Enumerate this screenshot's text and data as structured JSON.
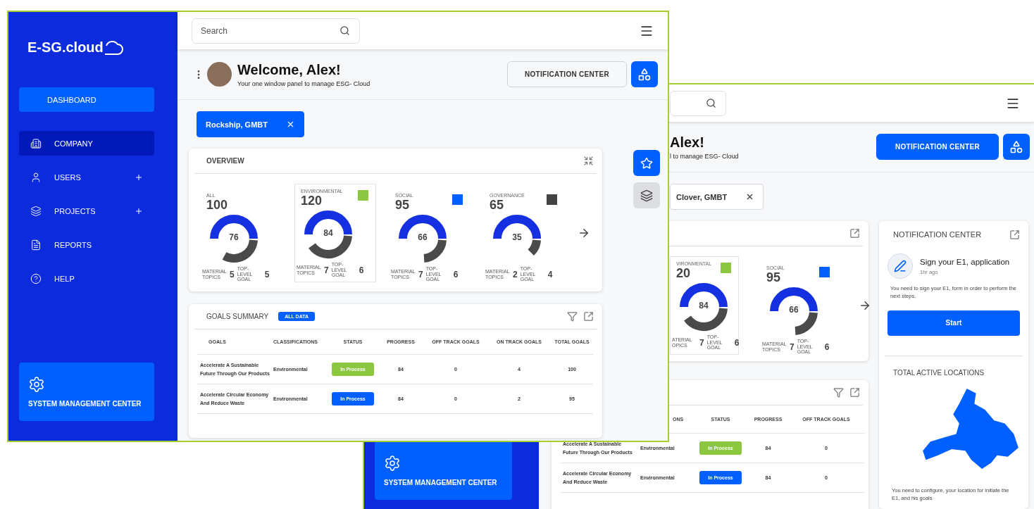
{
  "front": {
    "sidebar": {
      "logo": "E-SG.cloud",
      "items": [
        {
          "label": "DASHBOARD",
          "kind": "button",
          "selected": false,
          "expandable": false
        },
        {
          "label": "COMPANY",
          "kind": "link",
          "selected": true,
          "expandable": false
        },
        {
          "label": "USERS",
          "kind": "link",
          "selected": false,
          "expandable": true
        },
        {
          "label": "PROJECTS",
          "kind": "link",
          "selected": false,
          "expandable": true
        },
        {
          "label": "REPORTS",
          "kind": "link",
          "selected": false,
          "expandable": false
        },
        {
          "label": "HELP",
          "kind": "link",
          "selected": false,
          "expandable": false
        }
      ],
      "system_button": "SYSTEM MANAGEMENT CENTER"
    },
    "search": {
      "placeholder": "Search"
    },
    "welcome": {
      "title": "Welcome, Alex!",
      "subtitle": "Your one window panel to manage ESG- Cloud"
    },
    "notification_button": {
      "label": "NOTIFICATION CENTER",
      "filled": false
    },
    "chip": {
      "label": "Rockship, GMBT",
      "filled": true
    },
    "overview": {
      "title": "OVERVIEW",
      "items": [
        {
          "label": "ALL",
          "value": "100",
          "center": "76",
          "material_label": "MATERIAL TOPICS",
          "material": "5",
          "goal_label": "TOP-LEVEL GOAL",
          "goals": "5",
          "selected": false
        },
        {
          "label": "ENVIRONMENTAL",
          "value": "120",
          "color": "#8dc63f",
          "center": "84",
          "material_label": "MATERIAL TOPICS",
          "material": "7",
          "goal_label": "TOP-LEVEL GOAL",
          "goals": "6",
          "selected": true
        },
        {
          "label": "SOCIAL",
          "value": "95",
          "color": "#0060ff",
          "center": "66",
          "material_label": "MATERIAL TOPICS",
          "material": "7",
          "goal_label": "TOP-LEVEL GOAL",
          "goals": "6",
          "selected": false
        },
        {
          "label": "GOVERNANCE",
          "value": "65",
          "color": "#444444",
          "center": "35",
          "material_label": "MATERIAL TOPICS",
          "material": "2",
          "goal_label": "TOP-LEVEL GOAL",
          "goals": "4",
          "selected": false
        }
      ]
    },
    "goals": {
      "title": "GOALS SUMMARY",
      "badge": "ALL DATA",
      "columns": [
        "GOALS",
        "CLASSIFICATIONS",
        "STATUS",
        "PROGRESS",
        "OFF TRACK GOALS",
        "ON TRACK GOALS",
        "TOTAL GOALS"
      ],
      "rows": [
        {
          "cells": [
            "Accelerate A Sustainable Future Through Our Products",
            "Environmental",
            {
              "label": "In Process",
              "color": "#8dc63f"
            },
            "84",
            "0",
            "4",
            "100"
          ]
        },
        {
          "cells": [
            "Accelerate Circular Economy And Reduce Waste",
            "Environmental",
            {
              "label": "In Process",
              "color": "#0060ff"
            },
            "84",
            "0",
            "2",
            "95"
          ]
        }
      ]
    }
  },
  "back": {
    "sidebar": {
      "system_button": "SYSTEM MANAGEMENT CENTER"
    },
    "welcome": {
      "title": "Alex!",
      "subtitle": "l to manage ESG- Cloud"
    },
    "notification_button": {
      "label": "NOTIFICATION CENTER",
      "filled": true
    },
    "chip": {
      "label": "Clover, GMBT",
      "filled": false
    },
    "overview": {
      "items": [
        {
          "label": "VIRONMENTAL",
          "value": "20",
          "color": "#8dc63f",
          "center": "84",
          "material_label": "ATERIAL OPICS",
          "material": "7",
          "goal_label": "TOP-LEVEL GOAL",
          "goals": "6",
          "selected": true
        },
        {
          "label": "SOCIAL",
          "value": "95",
          "color": "#0060ff",
          "center": "66",
          "material_label": "MATERIAL TOPICS",
          "material": "7",
          "goal_label": "TOP-LEVEL GOAL",
          "goals": "6",
          "selected": false
        }
      ]
    },
    "goals": {
      "columns": [
        "",
        "ONS",
        "STATUS",
        "PROGRESS",
        "OFF TRACK GOALS"
      ],
      "rows": [
        {
          "cells": [
            "Accelerate A Sustainable Future Through Our Products",
            "Environmental",
            {
              "label": "In Process",
              "color": "#8dc63f"
            },
            "84",
            "0"
          ]
        },
        {
          "cells": [
            "Accelerate Circular Economy And Reduce Waste",
            "Environmental",
            {
              "label": "In Process",
              "color": "#0060ff"
            },
            "84",
            "0"
          ]
        }
      ]
    },
    "notification_card": {
      "title": "NOTIFICATION CENTER",
      "message": "Sign your E1, application",
      "time": "1hr ago",
      "description": "You need to sign your E1, form in order to perform the next steps.",
      "button": "Start",
      "locations_title": "TOTAL ACTIVE LOCATIONS",
      "locations_note": "You need to configure, your location for initiate the E1, and his goals"
    }
  }
}
